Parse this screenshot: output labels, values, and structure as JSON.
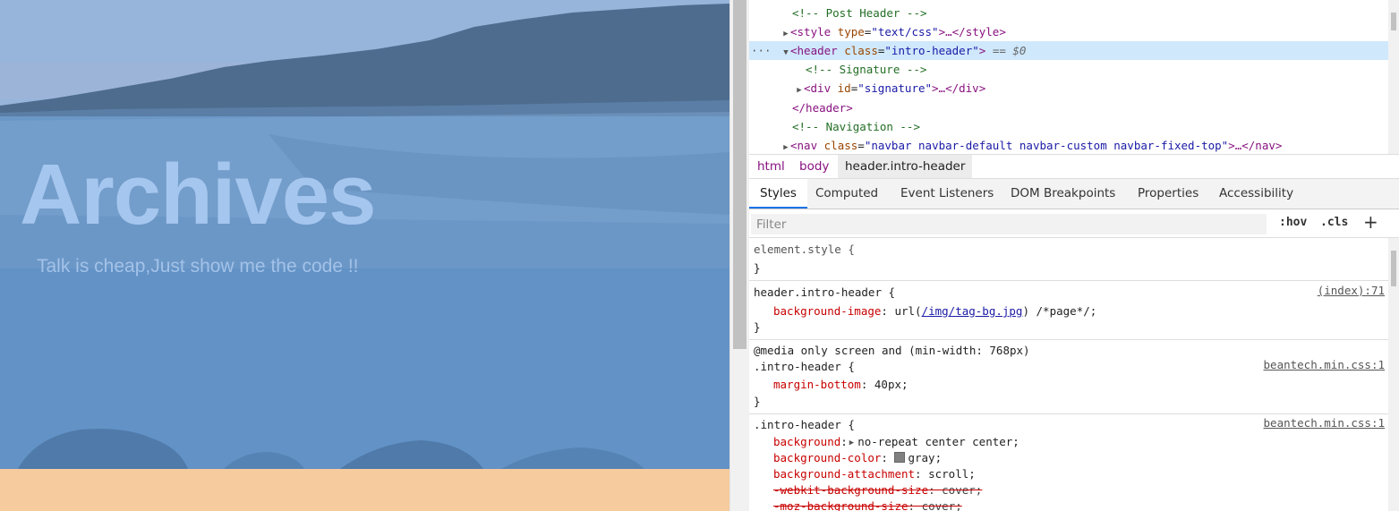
{
  "page": {
    "title": "Archives",
    "subtitle": "Talk is cheap,Just show me the code !!"
  },
  "dom_tree": {
    "lines": [
      {
        "comment": "<!-- Post Header -->"
      },
      {
        "open": "<style",
        "attr": "type",
        "val": "\"text/css\"",
        "rest": ">…</style>"
      },
      {
        "open": "<header",
        "attr": "class",
        "val": "\"intro-header\"",
        "rest": ">",
        "marker": "== $0",
        "dots": "···"
      },
      {
        "comment": "<!-- Signature -->"
      },
      {
        "open": "<div",
        "attr": "id",
        "val": "\"signature\"",
        "rest": ">…</div>"
      },
      {
        "close": "</header>"
      },
      {
        "comment": "<!-- Navigation -->"
      },
      {
        "open": "<nav",
        "attr": "class",
        "val": "\"navbar navbar-default navbar-custom navbar-fixed-top\"",
        "rest": ">…</nav>"
      }
    ]
  },
  "breadcrumb": [
    "html",
    "body",
    "header.intro-header"
  ],
  "tabs": [
    "Styles",
    "Computed",
    "Event Listeners",
    "DOM Breakpoints",
    "Properties",
    "Accessibility"
  ],
  "filter": {
    "placeholder": "Filter",
    "hov": ":hov",
    "cls": ".cls",
    "add": "+"
  },
  "styles": {
    "element_style": {
      "selector": "element.style {",
      "close": "}"
    },
    "rule1": {
      "selector": "header.intro-header {",
      "source": "(index):71",
      "prop": "background-image",
      "value_pre": ": url(",
      "link": "/img/tag-bg.jpg",
      "value_post": ") /*page*/;",
      "close": "}"
    },
    "rule2": {
      "media": "@media only screen and (min-width: 768px)",
      "selector": ".intro-header {",
      "source": "beantech.min.css:1",
      "prop": "margin-bottom",
      "value": ": 40px;",
      "close": "}"
    },
    "rule3": {
      "selector": ".intro-header {",
      "source": "beantech.min.css:1",
      "decls": [
        {
          "prop": "background",
          "value": "no-repeat center center;"
        },
        {
          "prop": "background-color",
          "value": "gray;"
        },
        {
          "prop": "background-attachment",
          "value": ": scroll;"
        },
        {
          "prop": "-webkit-background-size",
          "value": ": cover;"
        },
        {
          "prop": "-moz-background-size",
          "value": ": cover;"
        }
      ]
    }
  },
  "colors": {
    "selection": "#cfe8fc",
    "accent_tab": "#1a73e8",
    "peach_bar": "#f6cb9e"
  }
}
